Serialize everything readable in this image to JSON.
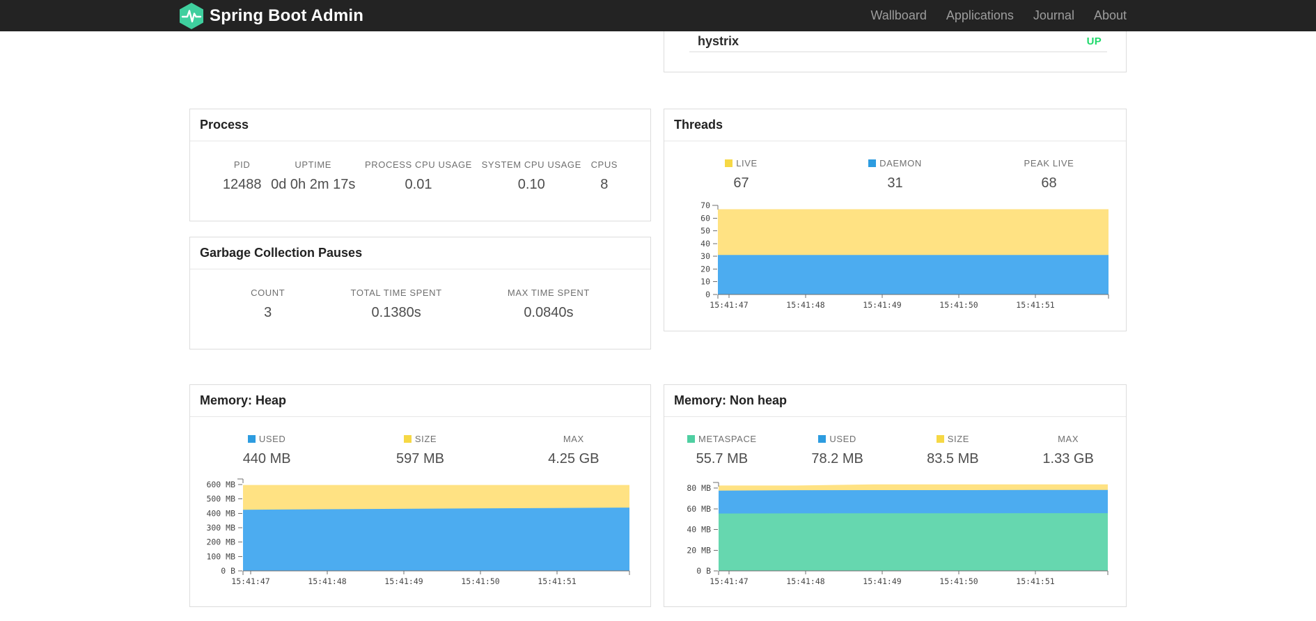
{
  "navbar": {
    "brand": "Spring Boot Admin",
    "links": [
      "Wallboard",
      "Applications",
      "Journal",
      "About"
    ]
  },
  "colors": {
    "accent_green": "#3fcf9e",
    "status_up": "#1fd96b",
    "series_blue": "#2d9ce0",
    "series_blue_area": "#4cacf0",
    "series_yellow": "#f6d845",
    "series_yellow_area": "#ffe283",
    "series_green": "#4fcfa2",
    "series_green_area": "#66d7af"
  },
  "application_row": {
    "name": "hystrix",
    "status": "UP"
  },
  "process": {
    "title": "Process",
    "stats": [
      {
        "label": "PID",
        "value": "12488"
      },
      {
        "label": "UPTIME",
        "value": "0d 0h 2m 17s"
      },
      {
        "label": "PROCESS CPU USAGE",
        "value": "0.01"
      },
      {
        "label": "SYSTEM CPU USAGE",
        "value": "0.10"
      },
      {
        "label": "CPUS",
        "value": "8"
      }
    ]
  },
  "gc": {
    "title": "Garbage Collection Pauses",
    "stats": [
      {
        "label": "COUNT",
        "value": "3"
      },
      {
        "label": "TOTAL TIME SPENT",
        "value": "0.1380s"
      },
      {
        "label": "MAX TIME SPENT",
        "value": "0.0840s"
      }
    ]
  },
  "threads": {
    "title": "Threads",
    "stats": [
      {
        "label": "LIVE",
        "value": "67",
        "swatch": "yellow"
      },
      {
        "label": "DAEMON",
        "value": "31",
        "swatch": "blue"
      },
      {
        "label": "PEAK LIVE",
        "value": "68"
      }
    ]
  },
  "heap": {
    "title": "Memory: Heap",
    "stats": [
      {
        "label": "USED",
        "value": "440 MB",
        "swatch": "blue"
      },
      {
        "label": "SIZE",
        "value": "597 MB",
        "swatch": "yellow"
      },
      {
        "label": "MAX",
        "value": "4.25 GB"
      }
    ]
  },
  "nonheap": {
    "title": "Memory: Non heap",
    "stats": [
      {
        "label": "METASPACE",
        "value": "55.7 MB",
        "swatch": "green"
      },
      {
        "label": "USED",
        "value": "78.2 MB",
        "swatch": "blue"
      },
      {
        "label": "SIZE",
        "value": "83.5 MB",
        "swatch": "yellow"
      },
      {
        "label": "MAX",
        "value": "1.33 GB"
      }
    ]
  },
  "chart_data": [
    {
      "id": "threads",
      "type": "area",
      "title": "Threads",
      "x_labels": [
        "15:41:47",
        "15:41:48",
        "15:41:49",
        "15:41:50",
        "15:41:51"
      ],
      "y_ticks": [
        {
          "value": 0,
          "label": "0"
        },
        {
          "value": 10,
          "label": "10"
        },
        {
          "value": 20,
          "label": "20"
        },
        {
          "value": 30,
          "label": "30"
        },
        {
          "value": 40,
          "label": "40"
        },
        {
          "value": 50,
          "label": "50"
        },
        {
          "value": 60,
          "label": "60"
        },
        {
          "value": 70,
          "label": "70"
        }
      ],
      "ylim": [
        0,
        70
      ],
      "legend_position": "top",
      "grid": false,
      "series": [
        {
          "name": "LIVE",
          "color": "yellow",
          "values": [
            67,
            67,
            67,
            67,
            67,
            67
          ]
        },
        {
          "name": "DAEMON",
          "color": "blue",
          "values": [
            31,
            31,
            31,
            31,
            31,
            31
          ]
        }
      ]
    },
    {
      "id": "heap",
      "type": "area",
      "title": "Memory: Heap",
      "x_labels": [
        "15:41:47",
        "15:41:48",
        "15:41:49",
        "15:41:50",
        "15:41:51"
      ],
      "y_ticks": [
        {
          "value": 0,
          "label": "0 B"
        },
        {
          "value": 100,
          "label": "100 MB"
        },
        {
          "value": 200,
          "label": "200 MB"
        },
        {
          "value": 300,
          "label": "300 MB"
        },
        {
          "value": 400,
          "label": "400 MB"
        },
        {
          "value": 500,
          "label": "500 MB"
        },
        {
          "value": 600,
          "label": "600 MB"
        }
      ],
      "ylim": [
        0,
        620
      ],
      "legend_position": "top",
      "grid": false,
      "series": [
        {
          "name": "SIZE",
          "color": "yellow",
          "values": [
            597,
            597,
            597,
            597,
            597,
            597
          ]
        },
        {
          "name": "USED",
          "color": "blue",
          "values": [
            425,
            428,
            431,
            434,
            437,
            440
          ]
        }
      ]
    },
    {
      "id": "nonheap",
      "type": "area",
      "title": "Memory: Non heap",
      "x_labels": [
        "15:41:47",
        "15:41:48",
        "15:41:49",
        "15:41:50",
        "15:41:51"
      ],
      "y_ticks": [
        {
          "value": 0,
          "label": "0 B"
        },
        {
          "value": 20,
          "label": "20 MB"
        },
        {
          "value": 40,
          "label": "40 MB"
        },
        {
          "value": 60,
          "label": "60 MB"
        },
        {
          "value": 80,
          "label": "80 MB"
        }
      ],
      "ylim": [
        0,
        85
      ],
      "legend_position": "top",
      "grid": false,
      "series": [
        {
          "name": "SIZE",
          "color": "yellow",
          "values": [
            82.4,
            82.4,
            83.5,
            83.5,
            83.5,
            83.5
          ]
        },
        {
          "name": "USED",
          "color": "blue",
          "values": [
            77.5,
            77.9,
            78.0,
            78.0,
            78.1,
            78.2
          ]
        },
        {
          "name": "METASPACE",
          "color": "green",
          "values": [
            55.4,
            55.5,
            55.6,
            55.6,
            55.7,
            55.7
          ]
        }
      ]
    }
  ]
}
